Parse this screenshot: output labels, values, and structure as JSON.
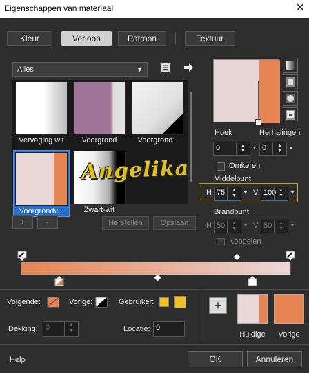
{
  "window": {
    "title": "Eigenschappen van materiaal",
    "close": "✕"
  },
  "tabs": [
    {
      "label": "Kleur"
    },
    {
      "label": "Verloop"
    },
    {
      "label": "Patroon"
    },
    {
      "label": "Textuur"
    }
  ],
  "library": {
    "category": "Alles",
    "swatches": [
      {
        "label": "Vervaging wit"
      },
      {
        "label": "Voorgrond"
      },
      {
        "label": "Voorgrond1"
      },
      {
        "label": "Voorgrondv..."
      },
      {
        "label": "Zwart-wit"
      }
    ],
    "add": "+",
    "remove": "-",
    "restore": "Herstellen",
    "save": "Opslaan"
  },
  "preview": {
    "angle_label": "Hoek",
    "angle_value": "0",
    "repeats_label": "Herhalingen",
    "repeats_value": "0",
    "invert_label": "Omkeren",
    "midpoint_label": "Middelpunt",
    "mid_h_label": "H",
    "mid_h_value": "75",
    "mid_v_label": "V",
    "mid_v_value": "100",
    "focus_label": "Brandpunt",
    "focus_h_label": "H",
    "focus_h_value": "50",
    "focus_v_label": "V",
    "focus_v_value": "50",
    "link_label": "Koppelen"
  },
  "editor": {
    "next_label": "Volgende:",
    "prev_label": "Vorige:",
    "user_label": "Gebruiker:",
    "opacity_label": "Dekking:",
    "opacity_value": "0",
    "location_label": "Locatie:",
    "location_value": "0",
    "add_button": "+",
    "current_label": "Huidige",
    "previous_label": "Vorige"
  },
  "colors": {
    "orange": "#e58553",
    "pink": "#e9d7d7",
    "user_yellow": "#f0c020",
    "select_blue": "#2a70c8"
  },
  "watermark": "Angelika",
  "footer": {
    "help": "Help",
    "ok": "OK",
    "cancel": "Annuleren"
  }
}
